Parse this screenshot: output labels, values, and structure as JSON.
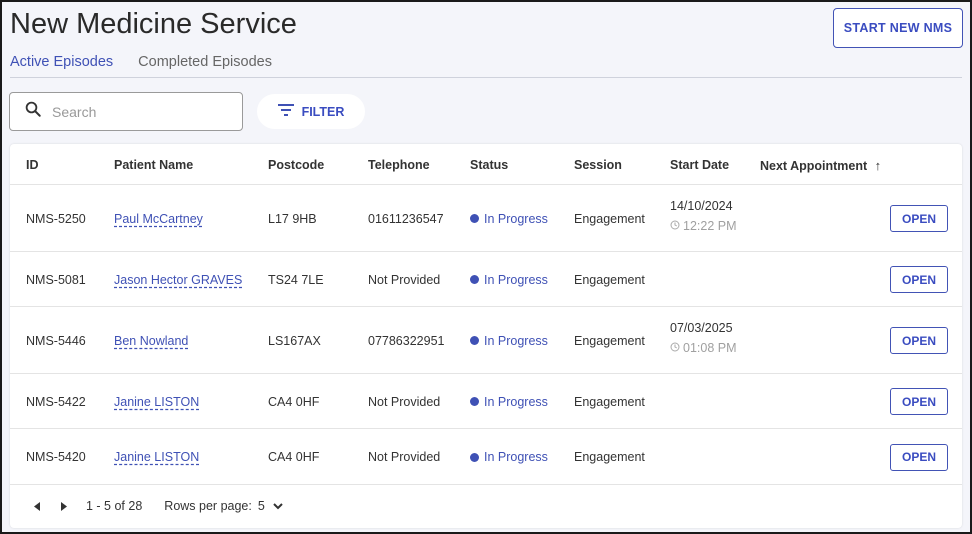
{
  "header": {
    "title": "New Medicine Service",
    "start_button_label": "START NEW NMS"
  },
  "tabs": [
    {
      "label": "Active Episodes",
      "active": true
    },
    {
      "label": "Completed Episodes",
      "active": false
    }
  ],
  "search": {
    "placeholder": "Search",
    "value": ""
  },
  "filter": {
    "label": "FILTER",
    "icon": "filter-icon"
  },
  "table": {
    "columns": [
      "ID",
      "Patient Name",
      "Postcode",
      "Telephone",
      "Status",
      "Session",
      "Start Date",
      "Next Appointment"
    ],
    "sort_indicator": "↑",
    "rows": [
      {
        "id": "NMS-5250",
        "patient": "Paul McCartney",
        "postcode": "L17 9HB",
        "telephone": "01611236547",
        "status": "In Progress",
        "session": "Engagement",
        "start_date": "14/10/2024",
        "start_time": "12:22 PM",
        "next_appointment": "",
        "action": "OPEN"
      },
      {
        "id": "NMS-5081",
        "patient": "Jason Hector GRAVES",
        "postcode": "TS24 7LE",
        "telephone": "Not Provided",
        "status": "In Progress",
        "session": "Engagement",
        "start_date": "",
        "start_time": "",
        "next_appointment": "",
        "action": "OPEN"
      },
      {
        "id": "NMS-5446",
        "patient": "Ben Nowland",
        "postcode": "LS167AX",
        "telephone": "07786322951",
        "status": "In Progress",
        "session": "Engagement",
        "start_date": "07/03/2025",
        "start_time": "01:08 PM",
        "next_appointment": "",
        "action": "OPEN"
      },
      {
        "id": "NMS-5422",
        "patient": "Janine LISTON",
        "postcode": "CA4 0HF",
        "telephone": "Not Provided",
        "status": "In Progress",
        "session": "Engagement",
        "start_date": "",
        "start_time": "",
        "next_appointment": "",
        "action": "OPEN"
      },
      {
        "id": "NMS-5420",
        "patient": "Janine LISTON",
        "postcode": "CA4 0HF",
        "telephone": "Not Provided",
        "status": "In Progress",
        "session": "Engagement",
        "start_date": "",
        "start_time": "",
        "next_appointment": "",
        "action": "OPEN"
      }
    ]
  },
  "pagination": {
    "range": "1 - 5 of 28",
    "rows_per_page_label": "Rows per page:",
    "rows_per_page": "5"
  },
  "colors": {
    "accent": "#3f51b5",
    "background": "#f4f5fa"
  }
}
